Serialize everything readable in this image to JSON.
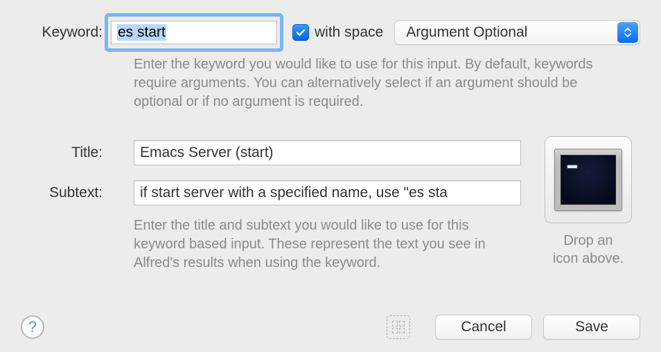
{
  "labels": {
    "keyword": "Keyword:",
    "title": "Title:",
    "subtext": "Subtext:",
    "with_space": "with space"
  },
  "fields": {
    "keyword_value": "es start",
    "title_value": "Emacs Server (start)",
    "subtext_value": "if start server with a specified name, use \"es sta"
  },
  "argument_select": {
    "selected": "Argument Optional"
  },
  "checkbox": {
    "with_space_checked": true
  },
  "help": {
    "keyword": "Enter the keyword you would like to use for this input. By default, keywords require arguments. You can alternatively select if an argument should be optional or if no argument is required.",
    "title_subtext": "Enter the title and subtext you would like to use for this keyword based input. These represent the text you see in Alfred's results when using the keyword."
  },
  "icon_drop": {
    "caption_line1": "Drop an",
    "caption_line2": "icon above."
  },
  "buttons": {
    "cancel": "Cancel",
    "save": "Save"
  },
  "help_button": "?"
}
